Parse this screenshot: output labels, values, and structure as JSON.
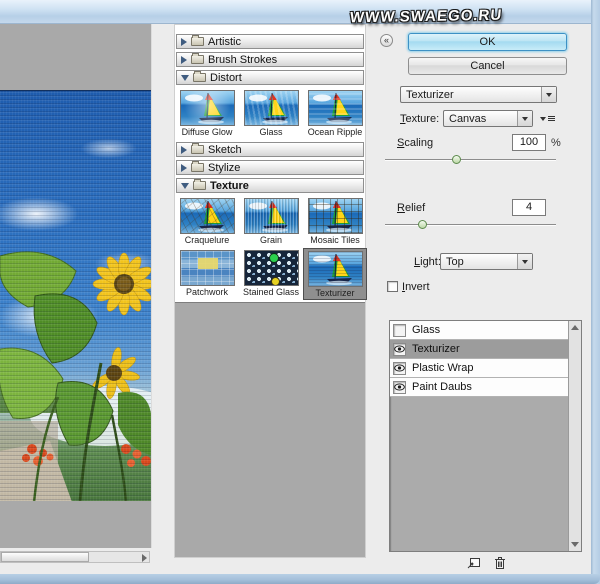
{
  "watermark_text": "WWW.SWAEGO.RU",
  "dialog": {
    "ok_label": "OK",
    "cancel_label": "Cancel",
    "collapse_glyph": "«",
    "filter_select_value": "Texturizer"
  },
  "categories": [
    {
      "label": "Artistic",
      "expanded": false
    },
    {
      "label": "Brush Strokes",
      "expanded": false
    },
    {
      "label": "Distort",
      "expanded": true,
      "items": [
        {
          "label": "Diffuse Glow"
        },
        {
          "label": "Glass"
        },
        {
          "label": "Ocean Ripple"
        }
      ]
    },
    {
      "label": "Sketch",
      "expanded": false
    },
    {
      "label": "Stylize",
      "expanded": false
    },
    {
      "label": "Texture",
      "expanded": true,
      "items": [
        {
          "label": "Craquelure"
        },
        {
          "label": "Grain"
        },
        {
          "label": "Mosaic Tiles"
        },
        {
          "label": "Patchwork"
        },
        {
          "label": "Stained Glass"
        },
        {
          "label": "Texturizer"
        }
      ]
    }
  ],
  "selected_thumbnail": "Texturizer",
  "controls": {
    "texture_label": "Texture:",
    "texture_value": "Canvas",
    "scaling_label": "Scaling",
    "scaling_value": "100",
    "scaling_unit": "%",
    "relief_label": "Relief",
    "relief_value": "4",
    "light_label": "Light:",
    "light_value": "Top",
    "invert_label": "Invert"
  },
  "effect_layers": [
    {
      "name": "Glass",
      "visible": false,
      "selected": false
    },
    {
      "name": "Texturizer",
      "visible": true,
      "selected": true
    },
    {
      "name": "Plastic Wrap",
      "visible": true,
      "selected": false
    },
    {
      "name": "Paint Daubs",
      "visible": true,
      "selected": false
    }
  ],
  "colors": {
    "ok_button_fill": "#bce4f4",
    "titlebar_blue": "#cfe2f3",
    "selected_row_gray": "#9c9c9c",
    "selected_thumb_bg": "#8f8f8f",
    "panel_gray": "#a9a9a9"
  }
}
